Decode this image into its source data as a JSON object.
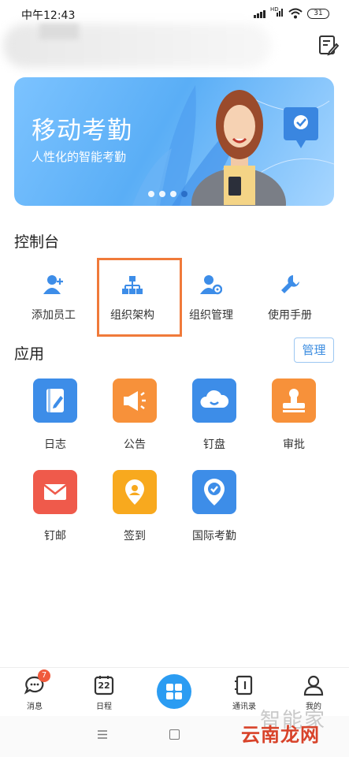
{
  "status_bar": {
    "time": "中午12:43",
    "battery": "31",
    "network": "HD"
  },
  "banner": {
    "title": "移动考勤",
    "subtitle": "人性化的智能考勤"
  },
  "console": {
    "heading": "控制台",
    "items": [
      {
        "label": "添加员工",
        "icon": "add-user-icon"
      },
      {
        "label": "组织架构",
        "icon": "org-chart-icon"
      },
      {
        "label": "组织管理",
        "icon": "user-settings-icon"
      },
      {
        "label": "使用手册",
        "icon": "wrench-icon"
      }
    ]
  },
  "apps": {
    "heading": "应用",
    "manage_label": "管理",
    "items": [
      {
        "label": "日志",
        "icon": "journal-icon",
        "color": "#3d8de8"
      },
      {
        "label": "公告",
        "icon": "megaphone-icon",
        "color": "#f7913a"
      },
      {
        "label": "钉盘",
        "icon": "cloud-icon",
        "color": "#3d8de8"
      },
      {
        "label": "审批",
        "icon": "stamp-icon",
        "color": "#f7913a"
      },
      {
        "label": "钉邮",
        "icon": "mail-icon",
        "color": "#ef5a4b"
      },
      {
        "label": "签到",
        "icon": "location-pin-icon",
        "color": "#f8a91e"
      },
      {
        "label": "国际考勤",
        "icon": "check-pin-icon",
        "color": "#3d8de8"
      }
    ]
  },
  "tabbar": {
    "items": [
      {
        "label": "消息",
        "icon": "chat-icon",
        "badge": "7"
      },
      {
        "label": "日程",
        "icon": "calendar-icon",
        "day": "22"
      },
      {
        "label": "",
        "icon": "workbench-icon"
      },
      {
        "label": "通讯录",
        "icon": "contacts-icon"
      },
      {
        "label": "我的",
        "icon": "profile-icon"
      }
    ]
  },
  "watermark": {
    "text": "云南龙网",
    "faint": "智能家"
  },
  "colors": {
    "accent": "#2b9cf2",
    "highlight": "#f07a3a"
  }
}
